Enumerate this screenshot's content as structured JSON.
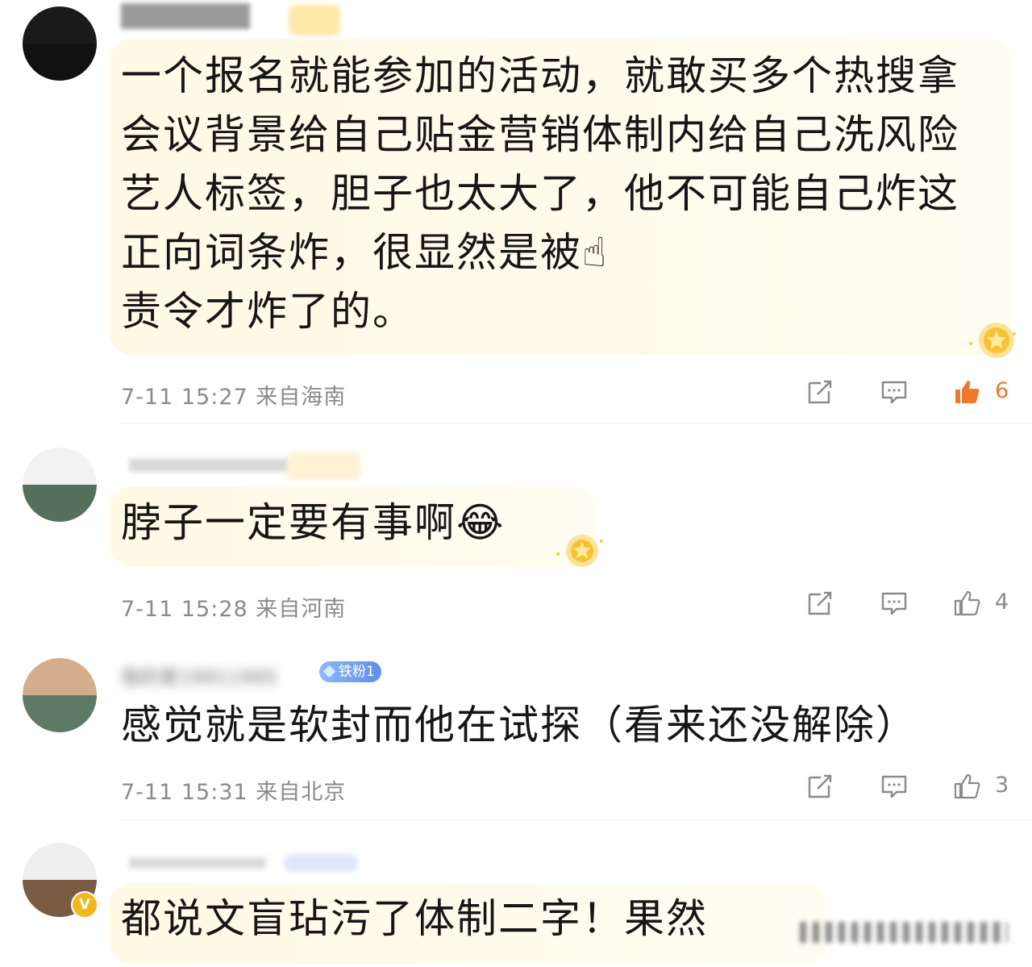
{
  "colors": {
    "bubble": "#fff8e3",
    "meta_text": "#8a8a8a",
    "liked": "#f0782a",
    "divider": "#ececec",
    "fan_badge": "#6f9cf0",
    "vip_badge": "#f2b71f"
  },
  "icons": {
    "repost": "repost-icon",
    "comment": "comment-icon",
    "like": "thumbs-up-icon",
    "medal": "gold-medal-icon",
    "emoji_pointing": "point-up-emoji",
    "emoji_laugh": "tears-of-joy-emoji"
  },
  "comments": [
    {
      "text": "一个报名就能参加的活动，就敢买多个热搜拿会议背景给自己贴金营销体制内给自己洗风险艺人标签，胆子也太大了，他不可能自己炸这正向词条炸，很显然是被",
      "emoji": "☝",
      "text_tail": "责令才炸了的。",
      "time": "7-11 15:27",
      "location": "来自海南",
      "likes": "6",
      "liked": true
    },
    {
      "text": "脖子一定要有事啊",
      "emoji": "😂",
      "time": "7-11 15:28",
      "location": "来自河南",
      "likes": "4",
      "liked": false
    },
    {
      "username": "我的爱19911995",
      "badge": "铁粉1",
      "text": "感觉就是软封而他在试探（看来还没解除）",
      "time": "7-11 15:31",
      "location": "来自北京",
      "likes": "3",
      "liked": false
    },
    {
      "text": "都说文盲玷污了体制二字！果然",
      "vip_mark": "V"
    }
  ]
}
